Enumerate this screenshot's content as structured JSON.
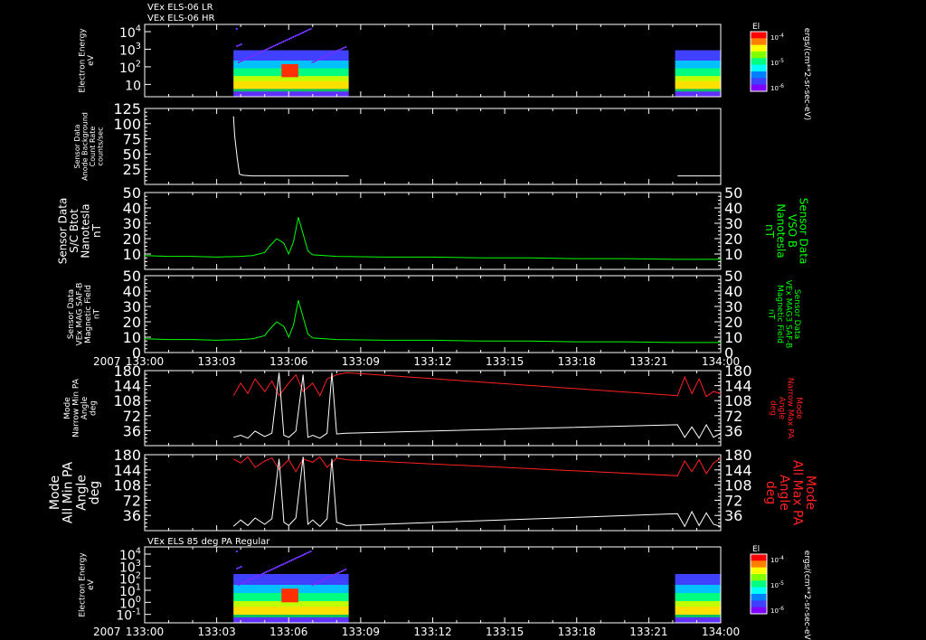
{
  "header": {
    "line1": "VEx ELS-06 LR",
    "line2": "VEx ELS-06 HR",
    "bottom_title": "VEx ELS 85 deg PA Regular"
  },
  "colors": {
    "white": "#ffffff",
    "green": "#00ff00",
    "red": "#ff2020",
    "background": "#000000"
  },
  "chart_data": [
    {
      "type": "heatmap",
      "ylabel": [
        "Electron Energy",
        "eV"
      ],
      "yticks": [
        "10^4",
        "10^3",
        "10^2",
        "10"
      ],
      "colorbar": {
        "label": "El",
        "ticks": [
          "10^-4",
          "10^-5",
          "10^-6"
        ],
        "unit": "ergs/(cm**2-sr-sec-eV)"
      }
    },
    {
      "type": "line",
      "ylabel": [
        "Sensor Data",
        "Anode Background",
        "Count Rate",
        "counts/sec"
      ],
      "yticks": [
        125,
        100,
        75,
        50,
        25
      ],
      "ylim": [
        0,
        125
      ],
      "series": [
        {
          "color": "#ffffff",
          "x": [
            3.7,
            3.75,
            3.85,
            3.95,
            4.1,
            4.5,
            5,
            6,
            7,
            8,
            8.5
          ],
          "y": [
            112,
            80,
            45,
            17,
            15,
            14,
            14,
            14,
            14,
            14,
            14
          ]
        },
        {
          "color": "#ffffff",
          "x": [
            22.2,
            23,
            24
          ],
          "y": [
            14,
            14,
            14
          ]
        }
      ]
    },
    {
      "type": "line",
      "ylabel": [
        "Sensor Data",
        "S/C Btot",
        "Nanotesla",
        "nT"
      ],
      "right_label": [
        "Sensor Data",
        "VSO B",
        "Nanotesla",
        "nT"
      ],
      "yticks": [
        50,
        40,
        30,
        20,
        10
      ],
      "ylim": [
        0,
        50
      ],
      "series": [
        {
          "color": "#00ff00",
          "x": [
            0,
            1,
            2,
            3,
            4,
            4.5,
            5,
            5.2,
            5.5,
            5.8,
            6,
            6.2,
            6.4,
            6.6,
            6.8,
            7,
            8,
            10,
            12,
            14,
            16,
            18,
            20,
            22,
            24
          ],
          "y": [
            9,
            8.5,
            8.5,
            8,
            8.5,
            9,
            11,
            15,
            20,
            17,
            10,
            18,
            34,
            23,
            12,
            9.5,
            8.5,
            8,
            8,
            7.5,
            7.5,
            7,
            7,
            6.5,
            6.5
          ]
        }
      ]
    },
    {
      "type": "line",
      "ylabel": [
        "Sensor Data",
        "VEx MAG SAF-B",
        "Magnetic Field",
        "nT"
      ],
      "right_label": [
        "Sensor Data",
        "VEx MAG3 SAF-B",
        "Magnetic Field",
        "nT"
      ],
      "yticks": [
        50,
        40,
        30,
        20,
        10,
        0
      ],
      "ylim": [
        0,
        50
      ],
      "xticks": [
        "133:00",
        "133:03",
        "133:06",
        "133:09",
        "133:12",
        "133:15",
        "133:18",
        "133:21",
        "134:00"
      ],
      "year": "2007",
      "series": [
        {
          "color": "#00ff00",
          "x": [
            0,
            1,
            2,
            3,
            4,
            4.5,
            5,
            5.2,
            5.5,
            5.8,
            6,
            6.2,
            6.4,
            6.6,
            6.8,
            7,
            8,
            10,
            12,
            14,
            16,
            18,
            20,
            22,
            24
          ],
          "y": [
            9,
            8.5,
            8.5,
            8,
            8.5,
            9,
            11,
            15,
            20,
            17,
            10,
            18,
            34,
            23,
            12,
            9.5,
            8.5,
            8,
            8,
            7.5,
            7.5,
            7,
            7,
            6.5,
            6.5
          ]
        }
      ]
    },
    {
      "type": "line",
      "ylabel": [
        "Mode",
        "Narrow Min PA",
        "Angle",
        "deg"
      ],
      "right_label": [
        "Mode",
        "Narrow Max PA",
        "Angle",
        "deg"
      ],
      "yticks": [
        180,
        144,
        108,
        72,
        36
      ],
      "ylim": [
        0,
        180
      ],
      "series": [
        {
          "color": "#ff2020",
          "x": [
            3.7,
            4.0,
            4.3,
            4.6,
            5.0,
            5.3,
            5.6,
            6.0,
            6.3,
            6.6,
            7.0,
            7.3,
            7.6,
            8.0,
            8.4,
            22.2,
            22.5,
            22.8,
            23.1,
            23.4,
            23.7,
            24
          ],
          "y": [
            120,
            150,
            125,
            160,
            130,
            155,
            120,
            150,
            170,
            130,
            150,
            120,
            160,
            170,
            175,
            120,
            165,
            125,
            160,
            118,
            130,
            125
          ]
        },
        {
          "color": "#ffffff",
          "x": [
            3.7,
            4.0,
            4.3,
            4.6,
            5.0,
            5.3,
            5.6,
            5.8,
            6.0,
            6.3,
            6.6,
            6.8,
            7.0,
            7.3,
            7.6,
            7.8,
            8.0,
            8.4,
            22.2,
            22.5,
            22.8,
            23.1,
            23.4,
            23.7,
            24
          ],
          "y": [
            20,
            25,
            18,
            35,
            22,
            30,
            175,
            25,
            20,
            35,
            170,
            20,
            25,
            18,
            30,
            175,
            28,
            30,
            50,
            20,
            45,
            18,
            50,
            20,
            30
          ]
        }
      ]
    },
    {
      "type": "line",
      "ylabel": [
        "Mode",
        "All Min PA",
        "Angle",
        "deg"
      ],
      "right_label": [
        "Mode",
        "All Max PA",
        "Angle",
        "deg"
      ],
      "yticks": [
        180,
        144,
        108,
        72,
        36
      ],
      "ylim": [
        0,
        180
      ],
      "series": [
        {
          "color": "#ff2020",
          "x": [
            3.7,
            4.0,
            4.3,
            4.6,
            5.0,
            5.3,
            5.6,
            6.0,
            6.3,
            6.6,
            7.0,
            7.3,
            7.6,
            8.0,
            8.4,
            22.2,
            22.5,
            22.8,
            23.1,
            23.4,
            23.7,
            24
          ],
          "y": [
            170,
            160,
            175,
            150,
            165,
            172,
            145,
            168,
            140,
            170,
            162,
            175,
            150,
            172,
            168,
            130,
            165,
            140,
            168,
            135,
            160,
            172
          ]
        },
        {
          "color": "#ffffff",
          "x": [
            3.7,
            4.0,
            4.3,
            4.6,
            5.0,
            5.3,
            5.6,
            5.8,
            6.0,
            6.3,
            6.6,
            6.8,
            7.0,
            7.3,
            7.6,
            7.8,
            8.0,
            8.4,
            22.2,
            22.5,
            22.8,
            23.1,
            23.4,
            23.7,
            24
          ],
          "y": [
            10,
            25,
            12,
            30,
            15,
            28,
            170,
            20,
            12,
            30,
            175,
            15,
            25,
            10,
            28,
            170,
            20,
            12,
            40,
            10,
            45,
            12,
            42,
            15,
            10
          ]
        }
      ]
    },
    {
      "type": "heatmap",
      "ylabel": [
        "Electron Energy",
        "eV"
      ],
      "yticks": [
        "10^4",
        "10^3",
        "10^2",
        "10^1",
        "10^0",
        "10^-1"
      ],
      "xticks": [
        "133:00",
        "133:03",
        "133:06",
        "133:09",
        "133:12",
        "133:15",
        "133:18",
        "133:21",
        "134:00"
      ],
      "year": "2007",
      "colorbar": {
        "label": "El",
        "ticks": [
          "10^-4",
          "10^-5",
          "10^-6"
        ],
        "unit": "ergs/(cm**2-sr-sec-eV)"
      }
    }
  ]
}
